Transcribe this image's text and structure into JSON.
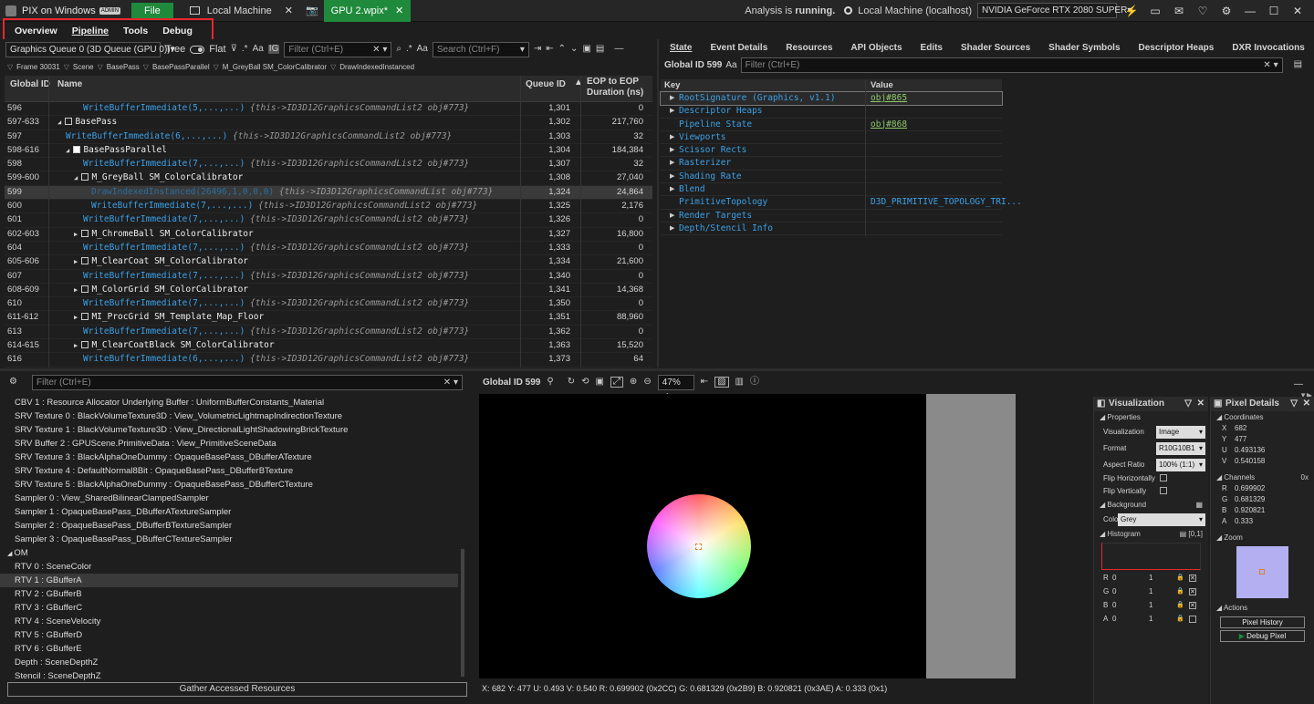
{
  "titlebar": {
    "app_title": "PIX on Windows",
    "admin_badge": "ADMIN",
    "file_label": "File",
    "tabs": [
      {
        "label": "Local Machine"
      },
      {
        "label": "GPU 2.wpix*"
      }
    ],
    "analysis_prefix": "Analysis is ",
    "analysis_status": "running.",
    "target": "Local Machine (localhost)",
    "gpu": "NVIDIA GeForce RTX 2080 SUPER"
  },
  "menu": [
    "Overview",
    "Pipeline",
    "Tools",
    "Debug"
  ],
  "events": {
    "queue": "Graphics Queue 0 (3D Queue (GPU 0))",
    "tree_label": "Tree",
    "flat_label": "Flat",
    "filter_placeholder": "Filter (Ctrl+E)",
    "search_placeholder": "Search (Ctrl+F)",
    "breadcrumb": [
      "Frame 30031",
      "Scene",
      "BasePass",
      "BasePassParallel",
      "M_GreyBall SM_ColorCalibrator",
      "DrawIndexedInstanced"
    ],
    "columns": {
      "global_id": "Global ID",
      "name": "Name",
      "queue_id": "Queue ID",
      "duration": "EOP to EOP",
      "duration2": "Duration (ns)"
    },
    "rows": [
      {
        "id": "596",
        "indent": 2,
        "kind": "call",
        "name": "WriteBufferImmediate(5,...,...)",
        "cmt": "{this->ID3D12GraphicsCommandList2 obj#773}",
        "queue": "1,301",
        "dur": "0"
      },
      {
        "id": "597-633",
        "indent": 0,
        "kind": "group",
        "name": "BasePass",
        "expand": "◢",
        "check": false,
        "queue": "1,302",
        "dur": "217,760"
      },
      {
        "id": "597",
        "indent": 1,
        "kind": "call",
        "name": "WriteBufferImmediate(6,...,...)",
        "cmt": "{this->ID3D12GraphicsCommandList2 obj#773}",
        "queue": "1,303",
        "dur": "32"
      },
      {
        "id": "598-616",
        "indent": 1,
        "kind": "group",
        "name": "BasePassParallel",
        "expand": "◢",
        "check": true,
        "queue": "1,304",
        "dur": "184,384"
      },
      {
        "id": "598",
        "indent": 2,
        "kind": "call",
        "name": "WriteBufferImmediate(7,...,...)",
        "cmt": "{this->ID3D12GraphicsCommandList2 obj#773}",
        "queue": "1,307",
        "dur": "32"
      },
      {
        "id": "599-600",
        "indent": 2,
        "kind": "group",
        "name": "M_GreyBall SM_ColorCalibrator",
        "expand": "◢",
        "check": false,
        "queue": "1,308",
        "dur": "27,040"
      },
      {
        "id": "599",
        "indent": 3,
        "kind": "callsel",
        "name": "DrawIndexedInstanced(26496,1,0,0,0)",
        "cmt": "{this->ID3D12GraphicsCommandList obj#773}",
        "queue": "1,324",
        "dur": "24,864",
        "selected": true
      },
      {
        "id": "600",
        "indent": 3,
        "kind": "call",
        "name": "WriteBufferImmediate(7,...,...)",
        "cmt": "{this->ID3D12GraphicsCommandList2 obj#773}",
        "queue": "1,325",
        "dur": "2,176"
      },
      {
        "id": "601",
        "indent": 2,
        "kind": "call",
        "name": "WriteBufferImmediate(7,...,...)",
        "cmt": "{this->ID3D12GraphicsCommandList2 obj#773}",
        "queue": "1,326",
        "dur": "0"
      },
      {
        "id": "602-603",
        "indent": 2,
        "kind": "group",
        "name": "M_ChromeBall SM_ColorCalibrator",
        "expand": "▶",
        "check": false,
        "queue": "1,327",
        "dur": "16,800"
      },
      {
        "id": "604",
        "indent": 2,
        "kind": "call",
        "name": "WriteBufferImmediate(7,...,...)",
        "cmt": "{this->ID3D12GraphicsCommandList2 obj#773}",
        "queue": "1,333",
        "dur": "0"
      },
      {
        "id": "605-606",
        "indent": 2,
        "kind": "group",
        "name": "M_ClearCoat SM_ColorCalibrator",
        "expand": "▶",
        "check": false,
        "queue": "1,334",
        "dur": "21,600"
      },
      {
        "id": "607",
        "indent": 2,
        "kind": "call",
        "name": "WriteBufferImmediate(7,...,...)",
        "cmt": "{this->ID3D12GraphicsCommandList2 obj#773}",
        "queue": "1,340",
        "dur": "0"
      },
      {
        "id": "608-609",
        "indent": 2,
        "kind": "group",
        "name": "M_ColorGrid SM_ColorCalibrator",
        "expand": "▶",
        "check": false,
        "queue": "1,341",
        "dur": "14,368"
      },
      {
        "id": "610",
        "indent": 2,
        "kind": "call",
        "name": "WriteBufferImmediate(7,...,...)",
        "cmt": "{this->ID3D12GraphicsCommandList2 obj#773}",
        "queue": "1,350",
        "dur": "0"
      },
      {
        "id": "611-612",
        "indent": 2,
        "kind": "group",
        "name": "MI_ProcGrid SM_Template_Map_Floor",
        "expand": "▶",
        "check": false,
        "queue": "1,351",
        "dur": "88,960"
      },
      {
        "id": "613",
        "indent": 2,
        "kind": "call",
        "name": "WriteBufferImmediate(7,...,...)",
        "cmt": "{this->ID3D12GraphicsCommandList2 obj#773}",
        "queue": "1,362",
        "dur": "0"
      },
      {
        "id": "614-615",
        "indent": 2,
        "kind": "group",
        "name": "M_ClearCoatBlack SM_ColorCalibrator",
        "expand": "▶",
        "check": false,
        "queue": "1,363",
        "dur": "15,520"
      },
      {
        "id": "616",
        "indent": 2,
        "kind": "call",
        "name": "WriteBufferImmediate(6,...,...)",
        "cmt": "{this->ID3D12GraphicsCommandList2 obj#773}",
        "queue": "1,373",
        "dur": "64"
      }
    ]
  },
  "state": {
    "tabs": [
      "State",
      "Event Details",
      "Resources",
      "API Objects",
      "Edits",
      "Shader Sources",
      "Shader Symbols",
      "Descriptor Heaps",
      "DXR Invocations"
    ],
    "global_label": "Global ID 599",
    "aa": "Aa",
    "filter_placeholder": "Filter (Ctrl+E)",
    "col_key": "Key",
    "col_value": "Value",
    "rows": [
      {
        "key": "RootSignature (Graphics, v1.1)",
        "value": "obj#865",
        "exp": true,
        "sel": true
      },
      {
        "key": "Descriptor Heaps",
        "value": "",
        "exp": true
      },
      {
        "key": "Pipeline State",
        "value": "obj#868",
        "exp": false
      },
      {
        "key": "Viewports",
        "value": "",
        "exp": true
      },
      {
        "key": "Scissor Rects",
        "value": "",
        "exp": true
      },
      {
        "key": "Rasterizer",
        "value": "",
        "exp": true
      },
      {
        "key": "Shading Rate",
        "value": "",
        "exp": true
      },
      {
        "key": "Blend",
        "value": "",
        "exp": true
      },
      {
        "key": "PrimitiveTopology",
        "value": "D3D_PRIMITIVE_TOPOLOGY_TRI...",
        "exp": false,
        "blue": true
      },
      {
        "key": "Render Targets",
        "value": "",
        "exp": true
      },
      {
        "key": "Depth/Stencil Info",
        "value": "",
        "exp": true
      }
    ]
  },
  "resources": {
    "filter_placeholder": "Filter (Ctrl+E)",
    "items": [
      {
        "t": "CBV 1 : Resource Allocator Underlying Buffer : UniformBufferConstants_Material"
      },
      {
        "t": "SRV Texture 0 : BlackVolumeTexture3D : View_VolumetricLightmapIndirectionTexture"
      },
      {
        "t": "SRV Texture 1 : BlackVolumeTexture3D : View_DirectionalLightShadowingBrickTexture"
      },
      {
        "t": "SRV Buffer 2 : GPUScene.PrimitiveData : View_PrimitiveSceneData"
      },
      {
        "t": "SRV Texture 3 : BlackAlphaOneDummy : OpaqueBasePass_DBufferATexture"
      },
      {
        "t": "SRV Texture 4 : DefaultNormal8Bit : OpaqueBasePass_DBufferBTexture"
      },
      {
        "t": "SRV Texture 5 : BlackAlphaOneDummy : OpaqueBasePass_DBufferCTexture"
      },
      {
        "t": "Sampler 0 : View_SharedBilinearClampedSampler"
      },
      {
        "t": "Sampler 1 : OpaqueBasePass_DBufferATextureSampler"
      },
      {
        "t": "Sampler 2 : OpaqueBasePass_DBufferBTextureSampler"
      },
      {
        "t": "Sampler 3 : OpaqueBasePass_DBufferCTextureSampler"
      },
      {
        "t": "OM",
        "header": true
      },
      {
        "t": "RTV 0 : SceneColor"
      },
      {
        "t": "RTV 1 : GBufferA",
        "sel": true
      },
      {
        "t": "RTV 2 : GBufferB"
      },
      {
        "t": "RTV 3 : GBufferC"
      },
      {
        "t": "RTV 4 : SceneVelocity"
      },
      {
        "t": "RTV 5 : GBufferD"
      },
      {
        "t": "RTV 6 : GBufferE"
      },
      {
        "t": "Depth : SceneDepthZ"
      },
      {
        "t": "Stencil : SceneDepthZ"
      }
    ],
    "gather_label": "Gather Accessed Resources"
  },
  "viewer": {
    "global_label": "Global ID 599",
    "zoom": "47%",
    "status": "X: 682  Y: 477  U: 0.493  V: 0.540  R: 0.699902 (0x2CC) G: 0.681329 (0x2B9) B: 0.920821 (0x3AE) A: 0.333 (0x1)"
  },
  "visualization": {
    "title": "Visualization",
    "properties": "Properties",
    "vis_label": "Visualization",
    "vis_value": "Image",
    "format_label": "Format",
    "format_value": "R10G10B1",
    "aspect_label": "Aspect Ratio",
    "aspect_value": "100% (1:1)",
    "flip_h": "Flip Horizontally",
    "flip_v": "Flip Vertically",
    "background": "Background",
    "color_label": "Color",
    "color_value": "Grey",
    "histogram": "Histogram",
    "range": "[0,1]",
    "channels": [
      {
        "c": "R",
        "lo": "0",
        "hi": "1"
      },
      {
        "c": "G",
        "lo": "0",
        "hi": "1"
      },
      {
        "c": "B",
        "lo": "0",
        "hi": "1"
      },
      {
        "c": "A",
        "lo": "0",
        "hi": "1"
      }
    ]
  },
  "pixel": {
    "title": "Pixel Details",
    "coordinates": "Coordinates",
    "coords": [
      {
        "k": "X",
        "v": "682"
      },
      {
        "k": "Y",
        "v": "477"
      },
      {
        "k": "U",
        "v": "0.493136"
      },
      {
        "k": "V",
        "v": "0.540158"
      }
    ],
    "channels_label": "Channels",
    "channels_suffix": "0x",
    "channels": [
      {
        "k": "R",
        "v": "0.699902"
      },
      {
        "k": "G",
        "v": "0.681329"
      },
      {
        "k": "B",
        "v": "0.920821"
      },
      {
        "k": "A",
        "v": "0.333"
      }
    ],
    "zoom_label": "Zoom",
    "actions_label": "Actions",
    "history_btn": "Pixel History",
    "debug_btn": "Debug Pixel"
  }
}
